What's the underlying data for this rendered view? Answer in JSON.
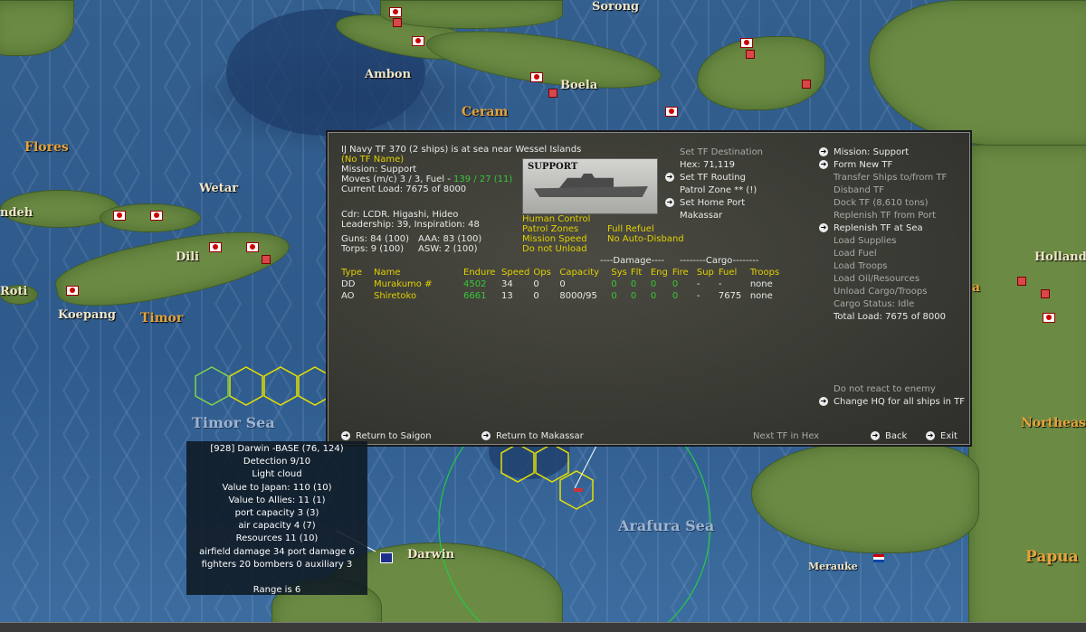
{
  "map": {
    "labels": {
      "sorong": "Sorong",
      "ambon": "Ambon",
      "boela": "Boela",
      "ceram": "Ceram",
      "flores": "Flores",
      "wetar": "Wetar",
      "ndeh": "ndeh",
      "dili": "Dili",
      "roti": "Roti",
      "koepang": "Koepang",
      "timor": "Timor",
      "timor_sea": "Timor Sea",
      "arafura_sea": "Arafura Sea",
      "darwin": "Darwin",
      "merauke": "Merauke",
      "hollandia": "Hollandia",
      "northeast": "Northeast",
      "papua": "Papua",
      "a_fragment": "a"
    }
  },
  "tf_panel": {
    "header": {
      "line1": "IJ Navy TF 370 (2 ships) is at sea near Wessel Islands",
      "tf_name": "(No TF Name)",
      "mission": "Mission: Support",
      "moves_prefix": "Moves (m/c) 3 / 3, Fuel - ",
      "moves_fuel": "139 / 27 (11)",
      "current_load": "Current Load: 7675 of 8000"
    },
    "commander": {
      "cdr": "Cdr: LCDR. Higashi, Hideo",
      "leadership": "Leadership: 39, Inspiration: 48"
    },
    "stats": {
      "guns": "Guns: 84 (100)",
      "aaa": "AAA: 83 (100)",
      "torps": "Torps: 9 (100)",
      "asw": "ASW: 2 (100)"
    },
    "ship_photo_label": "SUPPORT",
    "flags": {
      "human_control": "Human Control",
      "patrol_zones": "Patrol Zones",
      "full_refuel": "Full Refuel",
      "mission_speed": "Mission Speed",
      "no_auto_disband": "No Auto-Disband",
      "do_not_unload": "Do not Unload"
    },
    "destination": {
      "set_tf_destination": "Set TF Destination",
      "hex": "Hex: 71,119",
      "set_tf_routing": "Set TF Routing",
      "patrol_zone": "Patrol Zone ** (!)",
      "set_home_port": "Set Home Port",
      "home_port": "Makassar"
    },
    "table": {
      "damage_header": "----Damage----",
      "cargo_header": "--------Cargo--------",
      "columns": [
        "Type",
        "Name",
        "Endure",
        "Speed",
        "Ops",
        "Capacity",
        "Sys",
        "Flt",
        "Eng",
        "Fire",
        "Sup",
        "Fuel",
        "Troops"
      ],
      "rows": [
        [
          "DD",
          "Murakumo #",
          "4502",
          "34",
          "0",
          "0",
          "0",
          "0",
          "0",
          "0",
          "-",
          "-",
          "none"
        ],
        [
          "AO",
          "Shiretoko",
          "6661",
          "13",
          "0",
          "8000/95",
          "0",
          "0",
          "0",
          "0",
          "-",
          "7675",
          "none"
        ]
      ]
    },
    "right_menu": {
      "mission_support": "Mission: Support",
      "form_new_tf": "Form New TF",
      "transfer_ships": "Transfer Ships to/from TF",
      "disband_tf": "Disband TF",
      "dock_tf": "Dock TF (8,610 tons)",
      "replenish_port": "Replenish TF from Port",
      "replenish_sea": "Replenish TF at Sea",
      "load_supplies": "Load Supplies",
      "load_fuel": "Load Fuel",
      "load_troops": "Load Troops",
      "load_oil": "Load Oil/Resources",
      "unload_cargo": "Unload Cargo/Troops",
      "cargo_status": "Cargo Status: Idle",
      "total_load": "Total Load: 7675 of 8000",
      "do_not_react": "Do not react to enemy",
      "change_hq": "Change HQ for all ships in TF"
    },
    "bottom": {
      "return_saigon": "Return to Saigon",
      "return_makassar": "Return to Makassar",
      "next_tf": "Next TF in Hex",
      "back": "Back",
      "exit": "Exit"
    }
  },
  "base_panel": {
    "title": "[928] Darwin -BASE (76, 124)",
    "detection": "Detection 9/10",
    "weather": "Light cloud",
    "value_japan": "Value to Japan: 110 (10)",
    "value_allies": "Value to Allies: 11 (1)",
    "port_capacity": "port capacity 3 (3)",
    "air_capacity": "air capacity 4 (7)",
    "resources": "Resources  11 (10)",
    "damage": "airfield damage 34  port damage 6",
    "aircraft": "fighters 20  bombers 0  auxiliary 3",
    "range": "Range is 6"
  },
  "colors": {
    "ocean": "#2e5a8c",
    "land": "#6b8a44",
    "panel_bg": "#3a3a34",
    "highlight_yellow": "#e0d000",
    "value_green": "#38c838",
    "label_gold": "#e7a33a"
  }
}
